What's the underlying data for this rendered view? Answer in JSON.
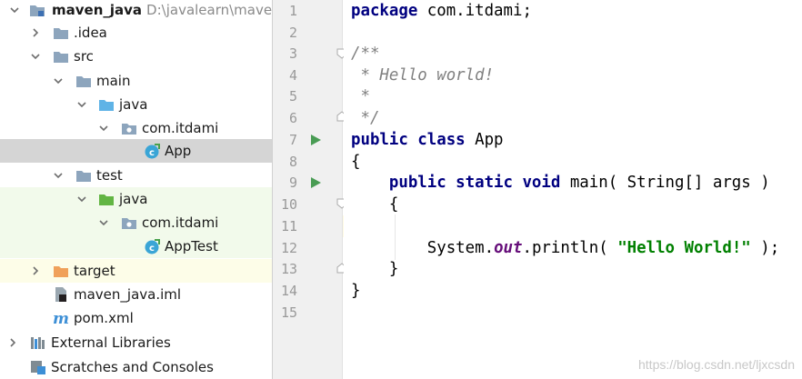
{
  "project_tree": {
    "items": [
      {
        "label": "maven_java",
        "hint": "D:\\javalearn\\maven_"
      },
      {
        "label": ".idea"
      },
      {
        "label": "src"
      },
      {
        "label": "main"
      },
      {
        "label": "java"
      },
      {
        "label": "com.itdami"
      },
      {
        "label": "App"
      },
      {
        "label": "test"
      },
      {
        "label": "java"
      },
      {
        "label": "com.itdami"
      },
      {
        "label": "AppTest"
      },
      {
        "label": "target"
      },
      {
        "label": "maven_java.iml"
      },
      {
        "label": "pom.xml"
      },
      {
        "label": "External Libraries"
      },
      {
        "label": "Scratches and Consoles"
      }
    ]
  },
  "editor": {
    "line_numbers": [
      "1",
      "2",
      "3",
      "4",
      "5",
      "6",
      "7",
      "8",
      "9",
      "10",
      "11",
      "12",
      "13",
      "14",
      "15"
    ],
    "lines": {
      "l1_kw": "package",
      "l1_rest": " com.itdami;",
      "l3": "/**",
      "l4": " * Hello world!",
      "l5": " *",
      "l6": " */",
      "l7_kw": "public class",
      "l7_rest": " App",
      "l8": "{",
      "l9_kw": "    public static void",
      "l9_rest": " main( String[] args )",
      "l10": "    {",
      "l12_a": "        System.",
      "l12_field": "out",
      "l12_b": ".println( ",
      "l12_str": "\"Hello World!\"",
      "l12_c": " );",
      "l13": "    }",
      "l14": "}"
    },
    "caret_line": 11
  },
  "watermark": "https://blog.csdn.net/ljxcsdn",
  "colors": {
    "keyword": "#000080",
    "comment": "#808080",
    "string": "#008000",
    "static_field": "#660e7a",
    "selection": "#d5d5d5",
    "caret_row": "#fffae3",
    "run_gutter": "#499c54"
  }
}
